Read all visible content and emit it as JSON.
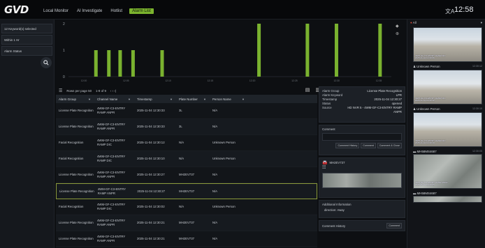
{
  "topbar": {
    "logo": "GVD",
    "nav": [
      "Local Monitor",
      "AI Investigate",
      "Hotlist",
      "Alarm List"
    ],
    "active_index": 3,
    "clock": "12:58"
  },
  "filters": {
    "keywords": "12 Keyword(s) selected",
    "range": "Within 1 Hr",
    "status": "Alarm Status"
  },
  "chart_data": {
    "type": "bar",
    "y_ticks": [
      "2",
      "1",
      "0"
    ],
    "ylim": [
      0,
      2
    ],
    "x": [
      0.085,
      0.125,
      0.16,
      0.2,
      0.29,
      0.59,
      0.74,
      0.83,
      0.965
    ],
    "values": [
      1,
      1,
      1,
      1,
      1,
      2,
      2,
      2,
      2
    ],
    "color": "#7ab22f",
    "x_tick_labels": [
      "12:00",
      "12:05",
      "12:10",
      "12:15",
      "12:20",
      "12:25",
      "12:30",
      "12:35"
    ]
  },
  "table": {
    "rows_per_page": "Rows per page 50",
    "range": "1-9 of 9",
    "nav": "‹  ›  ›|",
    "columns": [
      "Alarm Group",
      "Channel Name",
      "Timestamp",
      "Plate Number",
      "Person Name"
    ],
    "rows": [
      [
        "License Plate Recognition",
        "4WM-GF-C3-ENTRY RAMP ANPR",
        "2025-11-04 12:30:33",
        "3L",
        "N/A"
      ],
      [
        "License Plate Recognition",
        "4WM-GF-C3-ENTRY RAMP ANPR",
        "2025-11-04 12:30:33",
        "3L",
        "N/A"
      ],
      [
        "Facial Recognition",
        "4WM-GF-C3-ENTRY RAMP DIC",
        "2025-11-04 12:30:12",
        "N/A",
        "Unknown Person"
      ],
      [
        "Facial Recognition",
        "4WM-GF-C3-ENTRY RAMP DIC",
        "2025-11-04 12:30:10",
        "N/A",
        "Unknown Person"
      ],
      [
        "License Plate Recognition",
        "4WM-GF-C3-ENTRY RAMP ANPR",
        "2025-11-04 12:30:27",
        "MH2EV737",
        "N/A"
      ],
      [
        "License Plate Recognition",
        "4WM-GF-C3-ENTRY RAMP ANPR",
        "2025-11-04 12:30:27",
        "MH2EV737",
        "N/A"
      ],
      [
        "Facial Recognition",
        "4WM-GF-C3-ENTRY RAMP DIC",
        "2025-11-04 12:30:02",
        "N/A",
        "Unknown Person"
      ],
      [
        "License Plate Recognition",
        "4WM-GF-C3-ENTRY RAMP ANPR",
        "2025-11-04 12:30:21",
        "MH2EV737",
        "N/A"
      ],
      [
        "License Plate Recognition",
        "4WM-GF-C3-ENTRY RAMP ANPR",
        "2025-11-04 12:30:21",
        "MH2EV737",
        "N/A"
      ]
    ],
    "selected_row": 5
  },
  "detail": {
    "alarm_group_k": "Alarm Group",
    "alarm_group_v": "License Plate Recognition",
    "keyword_k": "Alarm Keyword",
    "keyword_v": "LPR",
    "timestamp_k": "Timestamp",
    "timestamp_v": "2025-11-04 12:30:27",
    "status_k": "Status",
    "status_v": "opened",
    "source_k": "Source",
    "source_v": "HD NVR 5 - 4WM-GF-C3-ENTRY RAMP ANPR",
    "comment_title": "Comment",
    "btn_history": "Comment History",
    "btn_comment": "Comment",
    "btn_close": "Comment & Close",
    "plate_title": "MH2EV737",
    "additional_title": "Additional Information",
    "direction": "direction: Away",
    "comment_history": "Comment History",
    "comment_btn2": "Comment"
  },
  "feed": {
    "head": "All",
    "cards": [
      {
        "label": "",
        "time": "",
        "cap1": "4WM-GF-C3-ENTRY RAMP DIC",
        "cap2": "2025-11-04 12:30:36"
      },
      {
        "label": "Unknown Person",
        "time": "12:30:12",
        "cap1": "4WM-GF-C3-ENTRY RAMP DIC",
        "cap2": "2025-11-04 12:30:12"
      },
      {
        "label": "Unknown Person",
        "time": "12:30:10",
        "cap1": "4WM-GF-C3-ENTRY RAMP DIC",
        "cap2": "2025-11-04 12:30:10"
      },
      {
        "label": "MH58MS4687",
        "time": "12:30:05",
        "cap1": "4WM-GF-C3-ENTRY RAMP ANPR",
        "cap2": "2025-11-04 12:30:05"
      },
      {
        "label": "MH58MS4687",
        "time": "",
        "cap1": "",
        "cap2": ""
      }
    ]
  }
}
